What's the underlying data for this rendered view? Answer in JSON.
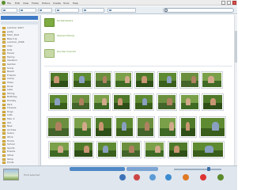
{
  "window": {
    "menus": [
      "File",
      "Edit",
      "View",
      "Folder",
      "Picture",
      "Create",
      "Tools",
      "Help"
    ]
  },
  "sidebar": {
    "items": [
      {
        "label": "summer 2007"
      },
      {
        "label": "party"
      },
      {
        "label": "Mom_Dad"
      },
      {
        "label": "Bike trip"
      },
      {
        "label": "summer_2006"
      },
      {
        "label": "misc"
      },
      {
        "label": "Kids"
      },
      {
        "label": "Travel"
      },
      {
        "label": "Family"
      },
      {
        "label": "Vacation"
      },
      {
        "label": "Garden"
      },
      {
        "label": "Snow"
      },
      {
        "label": "Beach"
      },
      {
        "label": "Friends"
      },
      {
        "label": "Camp"
      },
      {
        "label": "Trees"
      },
      {
        "label": "River"
      },
      {
        "label": "Lake"
      },
      {
        "label": "Hiking"
      },
      {
        "label": "Birthday"
      },
      {
        "label": "Holiday"
      },
      {
        "label": "Park"
      },
      {
        "label": "Flowers"
      },
      {
        "label": "Dogs"
      },
      {
        "label": "Cats"
      },
      {
        "label": "Misc 2"
      },
      {
        "label": "Old"
      },
      {
        "label": "New"
      },
      {
        "label": "Archive"
      },
      {
        "label": "Scans"
      },
      {
        "label": "Work"
      },
      {
        "label": "Home"
      },
      {
        "label": "School"
      },
      {
        "label": "Sports"
      },
      {
        "label": "Events"
      },
      {
        "label": "Other"
      },
      {
        "label": "Temp"
      },
      {
        "label": "Prints"
      }
    ]
  },
  "main": {
    "folders": [
      {
        "title": "Screensavers",
        "sub": ""
      },
      {
        "title": "Starred Photos",
        "sub": ""
      },
      {
        "title": "Quicker Imports",
        "sub": ""
      }
    ]
  },
  "tray": {
    "caption": "Hold selected"
  },
  "theme": {
    "accent": "#3d79c4",
    "green": "#6a9a3a",
    "tray_bg": "#dfe6ee"
  }
}
